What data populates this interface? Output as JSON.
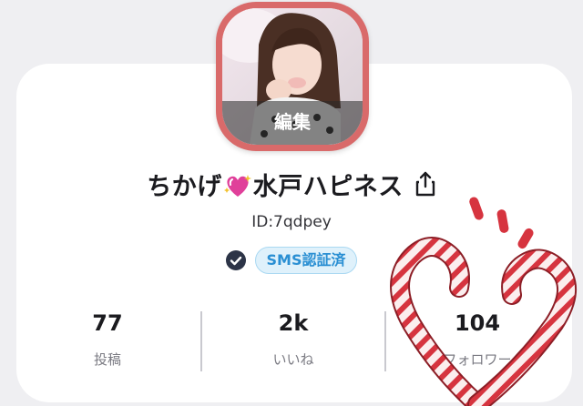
{
  "profile": {
    "edit_label": "編集",
    "name_part1": "ちかげ",
    "name_part2": "水戸ハピネス",
    "user_id": "ID:7qdpey",
    "verified_label": "SMS認証済"
  },
  "stats": [
    {
      "value": "77",
      "label": "投稿"
    },
    {
      "value": "2k",
      "label": "いいね"
    },
    {
      "value": "104",
      "label": "フォロワー"
    }
  ],
  "icons": {
    "heart": "sparkling-heart-icon",
    "share": "share-icon",
    "verified": "check-circle-icon",
    "decoration": "candy-cane-heart-sticker"
  },
  "colors": {
    "avatar_frame": "#d96a6a",
    "badge_text": "#2a8fd3",
    "badge_bg": "#dff1fb",
    "verified": "#2c3447"
  }
}
